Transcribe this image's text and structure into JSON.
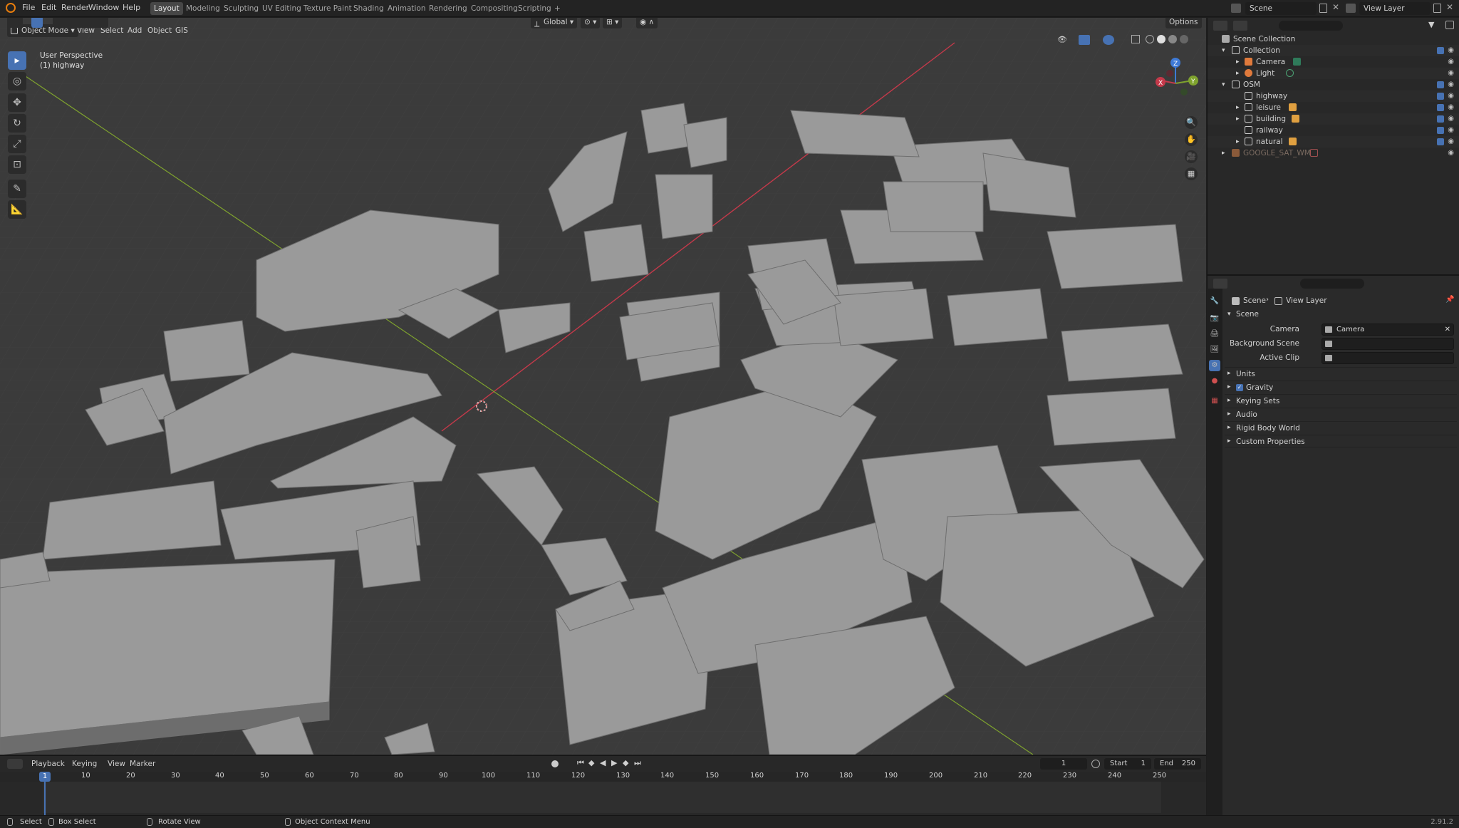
{
  "menus": [
    "File",
    "Edit",
    "Render",
    "Window",
    "Help"
  ],
  "workspaces": [
    "Layout",
    "Modeling",
    "Sculpting",
    "UV Editing",
    "Texture Paint",
    "Shading",
    "Animation",
    "Rendering",
    "Compositing",
    "Scripting",
    "+"
  ],
  "active_workspace": "Layout",
  "scene_field": "Scene",
  "view_layer_field": "View Layer",
  "viewport": {
    "mode": "Object Mode",
    "menus": [
      "View",
      "Select",
      "Add",
      "Object",
      "GIS"
    ],
    "transform_orientation": "Global",
    "options_label": "Options",
    "perspective_label": "User Perspective",
    "active_object_label": "(1) highway",
    "gizmo_axes": {
      "x": "X",
      "y": "Y",
      "z": "Z"
    }
  },
  "outliner": {
    "root": "Scene Collection",
    "rows": [
      {
        "label": "Collection",
        "depth": 1,
        "kind": "collection"
      },
      {
        "label": "Camera",
        "depth": 2,
        "kind": "camera"
      },
      {
        "label": "Light",
        "depth": 2,
        "kind": "light"
      },
      {
        "label": "OSM",
        "depth": 1,
        "kind": "collection"
      },
      {
        "label": "highway",
        "depth": 2,
        "kind": "mesh"
      },
      {
        "label": "leisure",
        "depth": 2,
        "kind": "mesh"
      },
      {
        "label": "building",
        "depth": 2,
        "kind": "mesh"
      },
      {
        "label": "railway",
        "depth": 2,
        "kind": "mesh"
      },
      {
        "label": "natural",
        "depth": 2,
        "kind": "mesh"
      },
      {
        "label": "GOOGLE_SAT_WM",
        "depth": 1,
        "kind": "image"
      }
    ]
  },
  "properties": {
    "breadcrumb_scene": "Scene",
    "breadcrumb_view_layer": "View Layer",
    "panel_title": "Scene",
    "camera_label": "Camera",
    "camera_value": "Camera",
    "background_scene_label": "Background Scene",
    "active_clip_label": "Active Clip",
    "subpanels": [
      "Units",
      "Gravity",
      "Keying Sets",
      "Audio",
      "Rigid Body World",
      "Custom Properties"
    ],
    "gravity_checked": true
  },
  "timeline": {
    "menus": [
      "Playback",
      "Keying",
      "View",
      "Marker"
    ],
    "current_frame": "1",
    "start_label": "Start",
    "start_value": "1",
    "end_label": "End",
    "end_value": "250",
    "ruler": [
      "10",
      "20",
      "30",
      "40",
      "50",
      "60",
      "70",
      "80",
      "90",
      "100",
      "110",
      "120",
      "130",
      "140",
      "150",
      "160",
      "170",
      "180",
      "190",
      "200",
      "210",
      "220",
      "230",
      "240",
      "250"
    ],
    "playhead": "1"
  },
  "statusbar": {
    "select": "Select",
    "box_select": "Box Select",
    "rotate_view": "Rotate View",
    "context_menu": "Object Context Menu",
    "version": "2.91.2"
  },
  "colors": {
    "accent": "#4772b3",
    "x_axis": "#c4394a",
    "y_axis": "#7fa32e",
    "z_axis": "#3e7ad6",
    "building": "#979797"
  }
}
